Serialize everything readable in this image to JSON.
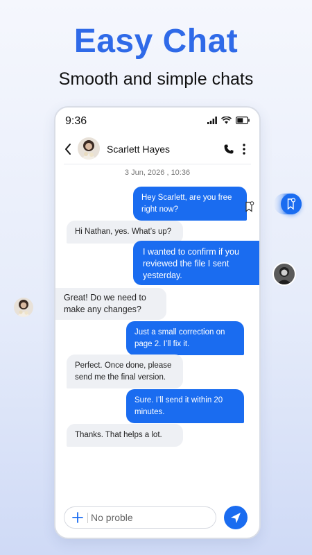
{
  "promo": {
    "headline": "Easy Chat",
    "subline": "Smooth and simple chats"
  },
  "status_bar": {
    "time": "9:36",
    "icons": [
      "signal-icon",
      "wifi-icon",
      "battery-icon"
    ]
  },
  "chat_header": {
    "contact_name": "Scarlett Hayes",
    "back_icon": "chevron-left-icon",
    "call_icon": "phone-icon",
    "more_icon": "vertical-dots-icon"
  },
  "date_label": "3 Jun, 2026 , 10:36",
  "messages": [
    {
      "direction": "outgoing",
      "text": "Hey Scarlett, are you free right now?"
    },
    {
      "direction": "incoming",
      "text": "Hi Nathan, yes. What’s up?"
    },
    {
      "direction": "outgoing",
      "text": "I wanted to confirm if you reviewed the file I sent yesterday."
    },
    {
      "direction": "incoming",
      "text": "Great! Do we need to make any changes?"
    },
    {
      "direction": "outgoing",
      "text": "Just a small correction on page 2. I’ll fix it."
    },
    {
      "direction": "incoming",
      "text": "Perfect. Once done, please send me the final version."
    },
    {
      "direction": "outgoing",
      "text": "Sure. I’ll send it within 20 minutes."
    },
    {
      "direction": "incoming",
      "text": "Thanks. That helps a lot."
    }
  ],
  "composer": {
    "value": "No proble",
    "plus_icon": "plus-icon",
    "send_icon": "send-icon"
  },
  "colors": {
    "accent": "#1a6cf0",
    "headline": "#2f6ae8",
    "incoming_bubble": "#eef0f4"
  }
}
